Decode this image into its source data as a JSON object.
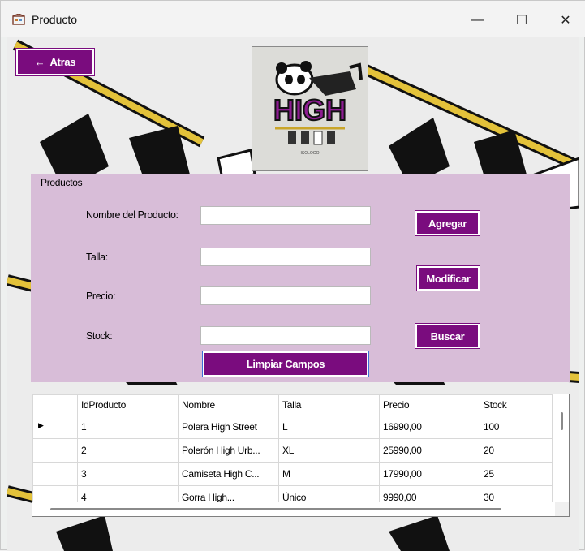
{
  "window": {
    "title": "Producto",
    "minimize_glyph": "—",
    "maximize_glyph": "☐",
    "close_glyph": "✕",
    "icon": "app-icon"
  },
  "toolbar": {
    "back_label": "Atras",
    "back_arrow": "←"
  },
  "logo": {
    "text": "HIGH",
    "subtext": "ISOLOGO"
  },
  "colors": {
    "accent": "#7a0c7e",
    "group_bg": "#d8bdd8"
  },
  "form": {
    "group_title": "Productos",
    "labels": {
      "nombre": "Nombre del Producto:",
      "talla": "Talla:",
      "precio": "Precio:",
      "stock": "Stock:"
    },
    "values": {
      "nombre": "",
      "talla": "",
      "precio": "",
      "stock": ""
    },
    "buttons": {
      "agregar": "Agregar",
      "modificar": "Modificar",
      "buscar": "Buscar",
      "limpiar": "Limpiar Campos"
    }
  },
  "table": {
    "columns": [
      "IdProducto",
      "Nombre",
      "Talla",
      "Precio",
      "Stock"
    ],
    "rows": [
      [
        "1",
        "Polera High Street",
        "L",
        "16990,00",
        "100"
      ],
      [
        "2",
        "Polerón High Urb...",
        "XL",
        "25990,00",
        "20"
      ],
      [
        "3",
        "Camiseta High C...",
        "M",
        "17990,00",
        "25"
      ],
      [
        "4",
        "Gorra High...",
        "Único",
        "9990,00",
        "30"
      ]
    ],
    "current_row_marker": "▶"
  }
}
